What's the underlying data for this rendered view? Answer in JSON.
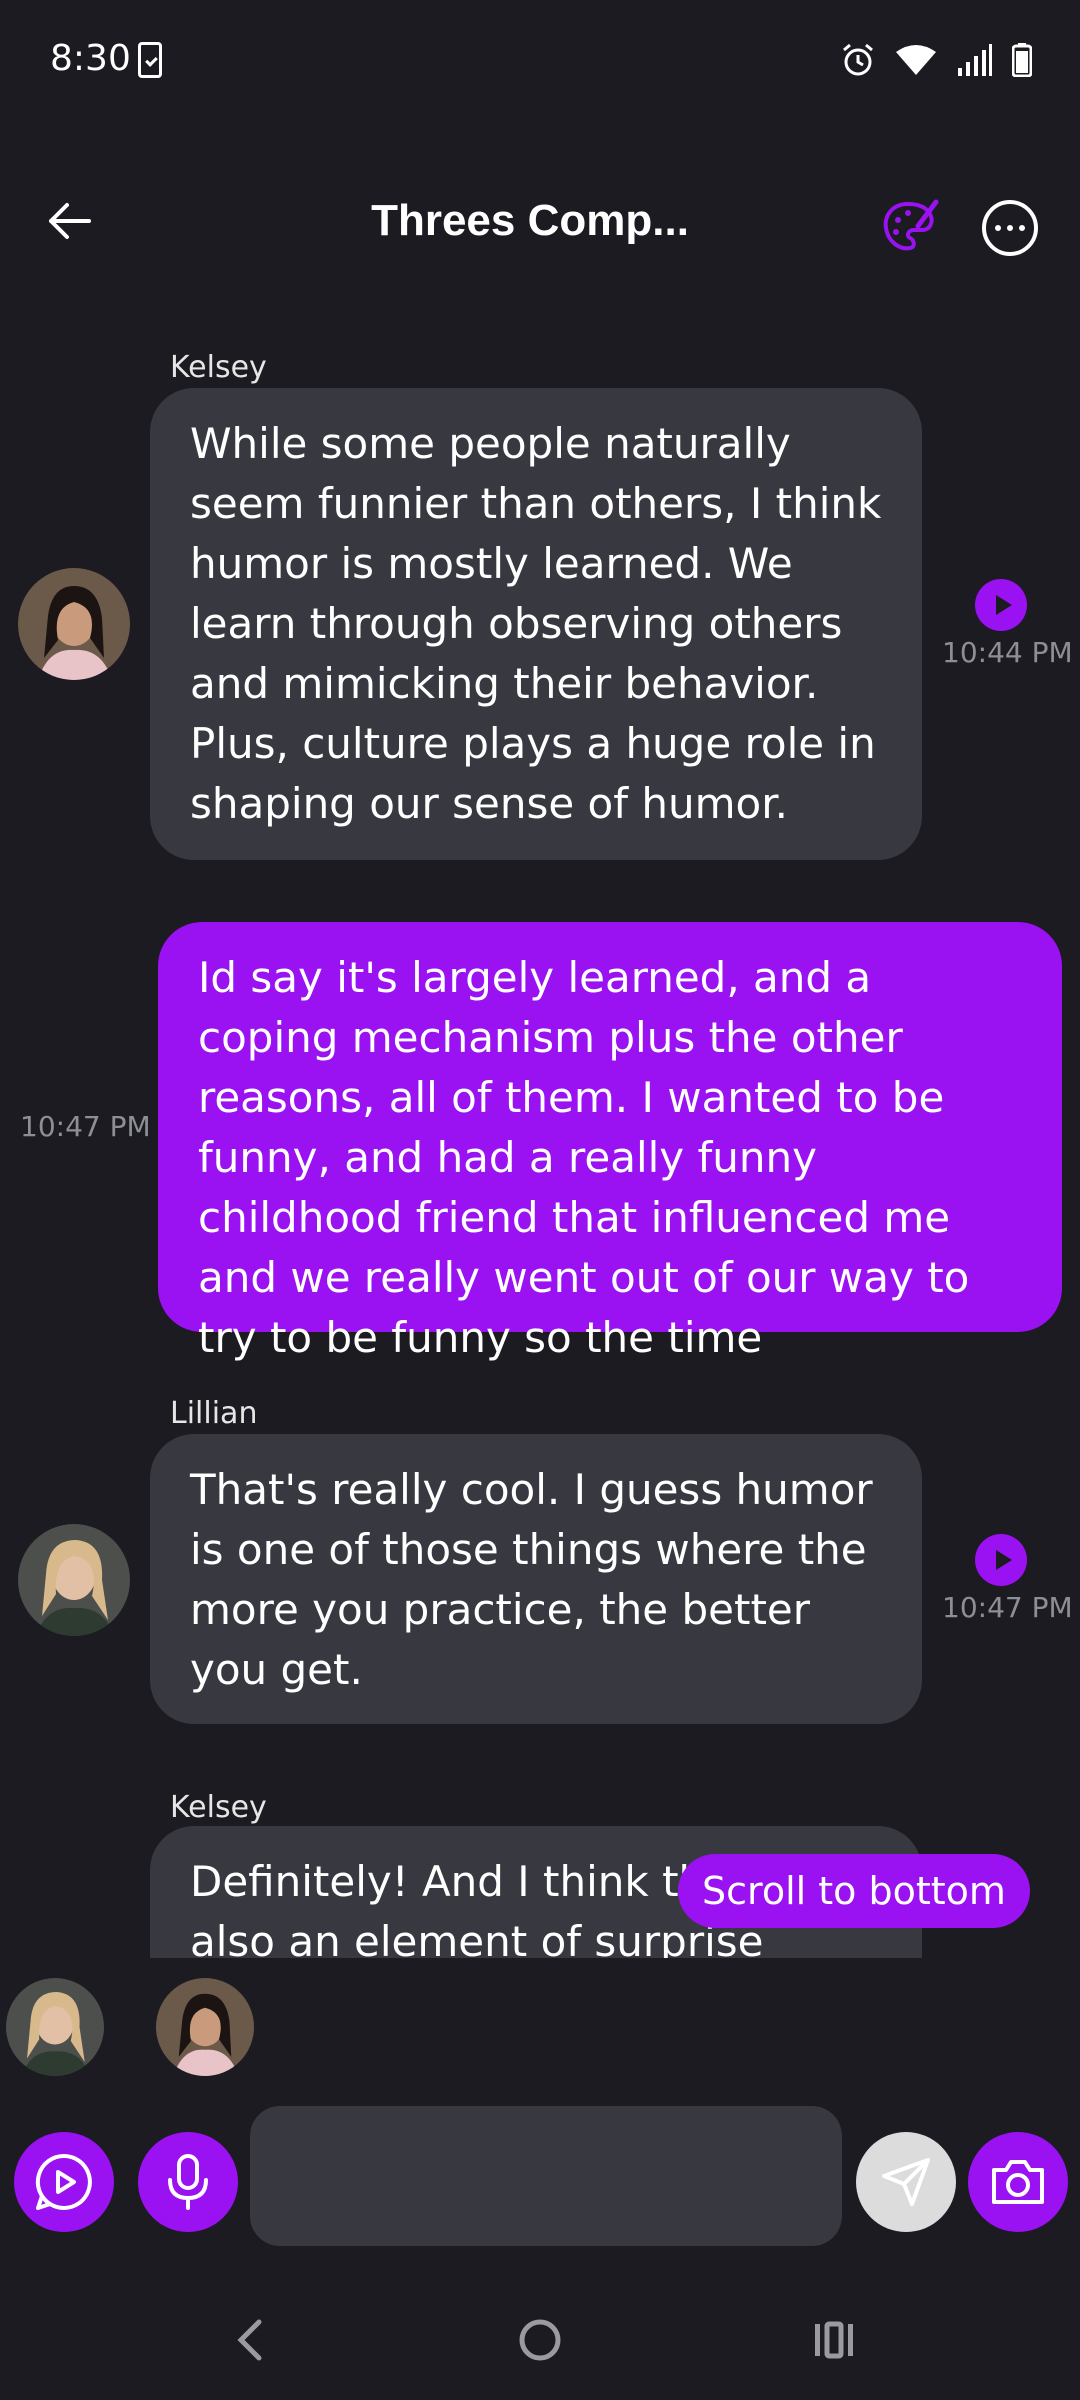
{
  "status_bar": {
    "time": "8:30"
  },
  "header": {
    "title": "Threes Comp..."
  },
  "messages": [
    {
      "sender": "Kelsey",
      "text": "While some people naturally seem funnier than others, I think humor is mostly learned. We learn through observing others and mimicking their behavior. Plus, culture plays a huge role in shaping our sense of humor.",
      "time": "10:44 PM"
    },
    {
      "text": "Id say it's largely learned, and a coping mechanism plus the other reasons, all of them. I wanted to be funny, and had a really funny childhood friend that influenced me and we really went out of our way to try to be funny so the time",
      "time": "10:47 PM"
    },
    {
      "sender": "Lillian",
      "text": "That's really cool. I guess humor is one of those things where the more you practice, the better you get.",
      "time": "10:47 PM"
    },
    {
      "sender": "Kelsey",
      "text": "Definitely! And I think there's also an element of surprise involved."
    }
  ],
  "scroll_to_bottom": "Scroll to bottom",
  "composer": {
    "placeholder": ""
  },
  "colors": {
    "accent": "#9a11f2",
    "incoming_bubble": "#383940",
    "background": "#1b1b21"
  }
}
